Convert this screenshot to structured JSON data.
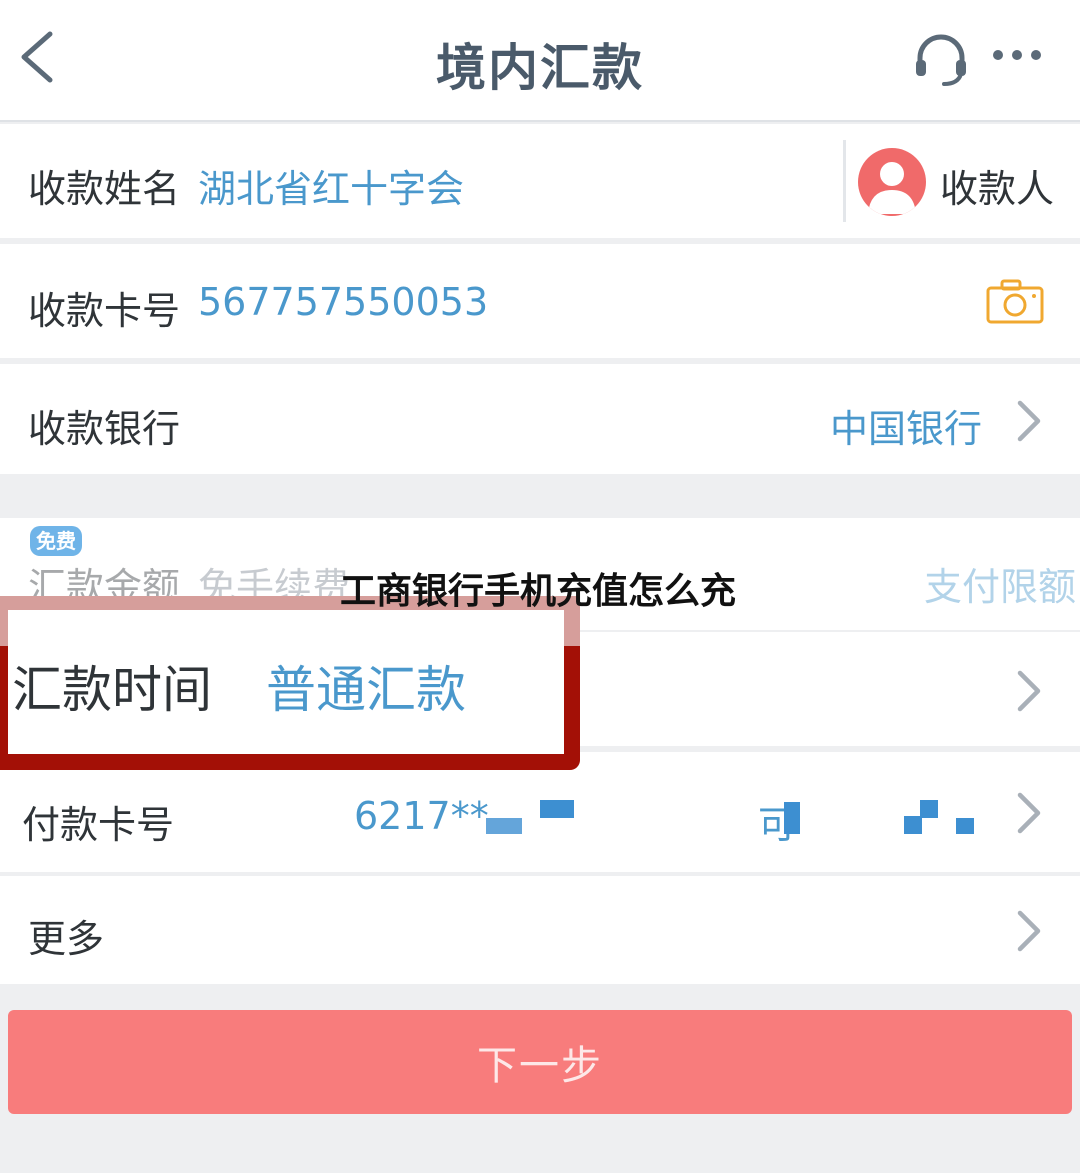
{
  "header": {
    "title": "境内汇款"
  },
  "payee_name": {
    "label": "收款姓名",
    "value": "湖北省红十字会",
    "payee_button": "收款人"
  },
  "card_no": {
    "label": "收款卡号",
    "value": "567757550053"
  },
  "bank": {
    "label": "收款银行",
    "value": "中国银行"
  },
  "amount": {
    "badge": "免费",
    "label": "汇款金额",
    "placeholder": "免手续费",
    "limit_link": "支付限额"
  },
  "overlay_caption": "工商银行手机充值怎么充",
  "remit_time": {
    "label": "汇款时间",
    "value": "普通汇款"
  },
  "payer_card": {
    "label": "付款卡号",
    "value": "6217**",
    "partial_right": "可"
  },
  "more": {
    "label": "更多"
  },
  "next_button": {
    "label": "下一步"
  },
  "colors": {
    "accent_blue": "#4a98cc",
    "button": "#f87c7c",
    "highlight_red": "#a31006",
    "camera_orange": "#f0a830"
  }
}
